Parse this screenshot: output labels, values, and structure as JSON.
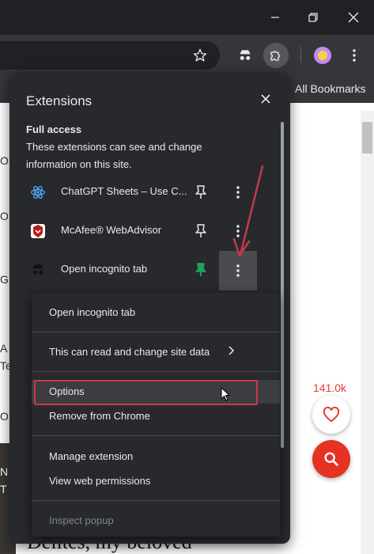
{
  "toolbar": {
    "bookmarks_label": "All Bookmarks"
  },
  "extensions_panel": {
    "title": "Extensions",
    "section_title": "Full access",
    "section_desc": "These extensions can see and change information on this site.",
    "extensions": [
      {
        "name": "ChatGPT Sheets – Use C...",
        "pinned": false
      },
      {
        "name": "McAfee® WebAdvisor",
        "pinned": false
      },
      {
        "name": "Open incognito tab",
        "pinned": true
      }
    ]
  },
  "context_menu": {
    "title_item": "Open incognito tab",
    "site_access": "This can read and change site data",
    "options": "Options",
    "remove": "Remove from Chrome",
    "manage": "Manage extension",
    "permissions": "View web permissions",
    "inspect": "Inspect popup"
  },
  "page": {
    "heading": "Delites, my beloved",
    "likes_count": "141.0k",
    "edge_letters": [
      "O",
      "O",
      "G",
      "A",
      "Te",
      "O",
      "N",
      "T"
    ]
  },
  "colors": {
    "pin_active": "#1ea362",
    "highlight": "#c8384d",
    "like_red": "#e43c36",
    "search_fab": "#e53223"
  }
}
